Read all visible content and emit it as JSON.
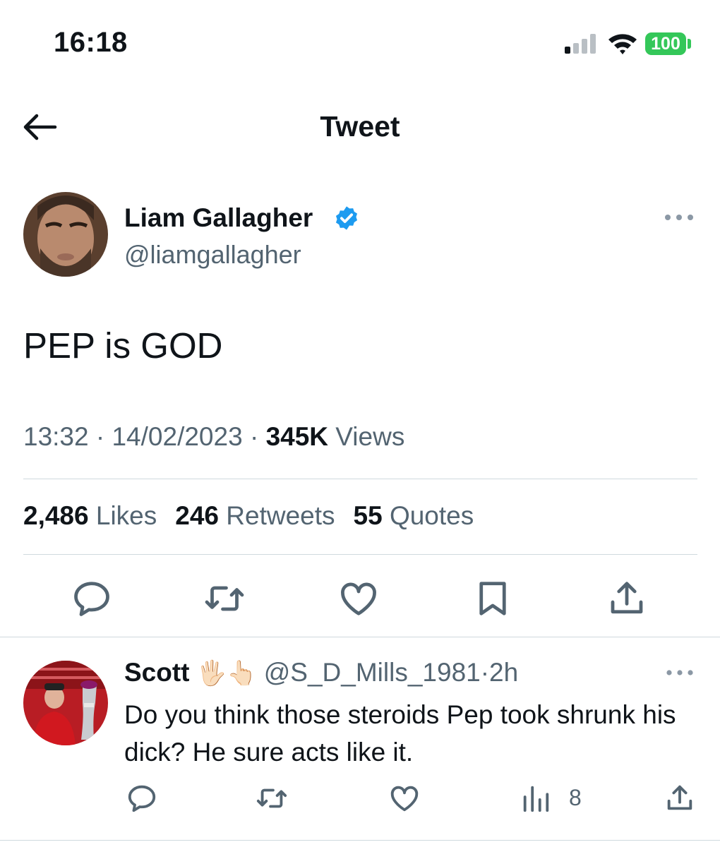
{
  "status_bar": {
    "time": "16:18",
    "battery": "100"
  },
  "header": {
    "title": "Tweet"
  },
  "tweet": {
    "author_name": "Liam Gallagher",
    "author_handle": "@liamgallagher",
    "text": "PEP is GOD",
    "time": "13:32",
    "date": "14/02/2023",
    "views_count": "345K",
    "views_label": "Views",
    "separator": "·",
    "likes_count": "2,486",
    "likes_label": "Likes",
    "retweets_count": "246",
    "retweets_label": "Retweets",
    "quotes_count": "55",
    "quotes_label": "Quotes"
  },
  "reply": {
    "author_name": "Scott",
    "emojis": "🖐🏻👆🏻",
    "author_handle": "@S_D_Mills_1981",
    "separator": "·",
    "age": "2h",
    "text": "Do you think those steroids Pep took shrunk his dick? He sure acts like it.",
    "views": "8"
  },
  "colors": {
    "accent": "#1d9bf0",
    "muted": "#536471",
    "text": "#0f1419",
    "divider": "#cfd9de",
    "battery": "#34c759"
  },
  "icons": [
    "back-arrow-icon",
    "verified-badge-icon",
    "more-icon",
    "reply-icon",
    "retweet-icon",
    "like-icon",
    "bookmark-icon",
    "share-icon",
    "views-chart-icon",
    "signal-icon",
    "wifi-icon"
  ]
}
